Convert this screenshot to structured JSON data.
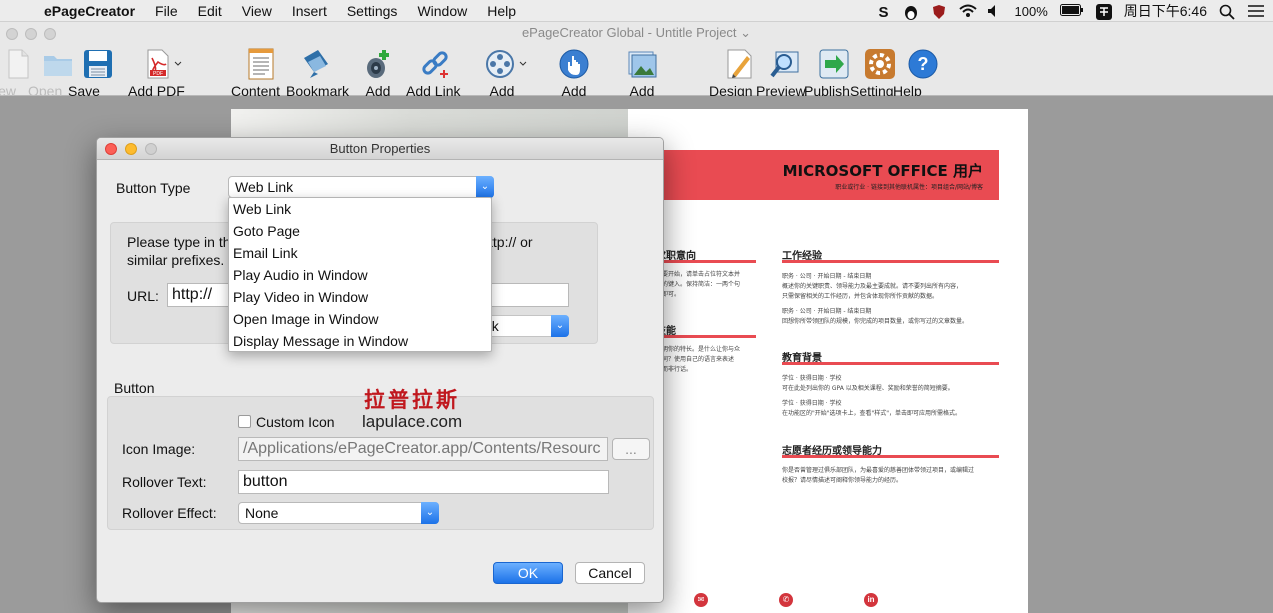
{
  "menubar": {
    "app_name": "ePageCreator",
    "items": [
      "File",
      "Edit",
      "View",
      "Insert",
      "Settings",
      "Window",
      "Help"
    ],
    "battery": "100%",
    "clock": "周日下午6:46"
  },
  "window": {
    "title": "ePageCreator Global - Untitle Project ⌄"
  },
  "toolbar": {
    "new_label": "New",
    "open_label": "Open",
    "save_label": "Save",
    "add_pdf_label": "Add PDF",
    "content_label": "Content",
    "bookmark_label": "Bookmark",
    "add_audio_label": "Add Audio",
    "add_link_label": "Add Link",
    "add_video_label": "Add Video",
    "add_button_label": "Add Button",
    "add_picture_label": "Add Picture",
    "design_label": "Design",
    "preview_label": "Preview",
    "publish_label": "Publish",
    "setting_label": "Setting",
    "help_label": "Help"
  },
  "resume": {
    "title": "MICROSOFT OFFICE 用户",
    "subtitle": "职业或行业  ·  链接到其他联机属性：项目组合/网站/博客",
    "left_heading1": "求职意向",
    "left_text1": [
      "要开始，请单击占位符文本并",
      "的键入。保持简洁：一两个句",
      "即可。"
    ],
    "left_heading2": "技能",
    "left_text2": [
      "明你的特长。是什么让你与众",
      "同？使用自己的语言来表述",
      "而非行话。"
    ],
    "heading_work": "工作经验",
    "work_text": [
      "职务 · 公司 · 开始日期 - 结束日期",
      "概述你的关键职责、领导能力及最主要成就。请不要列出所有内容，",
      "只需保留相关的工作经历，并包含体现你所作贡献的数据。",
      "",
      "职务 · 公司 · 开始日期 - 结束日期",
      "回想你所带领团队的规模，你完成的项目数量，或你写过的文章数量。"
    ],
    "heading_edu": "教育背景",
    "edu_text": [
      "学位 · 获得日期 · 学校",
      "可在此处列出你的 GPA 以及相关课程、奖励和荣誉的简短摘要。",
      "",
      "学位 · 获得日期 · 学校",
      "在功能区的\"开始\"选项卡上，查看\"样式\"，单击即可应用所需格式。"
    ],
    "heading_vol": "志愿者经历或领导能力",
    "vol_text": [
      "你是否曾管理过俱乐部团队，为最喜爱的慈善团体带领过项目，或编辑过",
      "校报？请尽情描述可阐释你领导能力的经历。"
    ]
  },
  "dialog": {
    "title": "Button Properties",
    "button_type_label": "Button Type",
    "button_type_value": "Web Link",
    "type_options": [
      "Web Link",
      "Goto Page",
      "Email Link",
      "Play Audio in Window",
      "Play Video in Window",
      "Open Image in Window",
      "Display Message in Window"
    ],
    "instructions_line1": "Please type in th",
    "instructions_line1_tail": "ttp:// or",
    "instructions_line2": "similar prefixes.",
    "url_label": "URL:",
    "url_value": "http://",
    "target_value_tail": "nk",
    "button_section_label": "Button",
    "custom_icon_label": "Custom Icon",
    "icon_image_label": "Icon Image:",
    "icon_image_value": "/Applications/ePageCreator.app/Contents/Resourc",
    "browse_label": "...",
    "rollover_text_label": "Rollover Text:",
    "rollover_text_value": "button",
    "rollover_effect_label": "Rollover Effect:",
    "rollover_effect_value": "None",
    "ok_label": "OK",
    "cancel_label": "Cancel"
  },
  "watermark": {
    "cn": "拉普拉斯",
    "en": "lapulace.com"
  }
}
